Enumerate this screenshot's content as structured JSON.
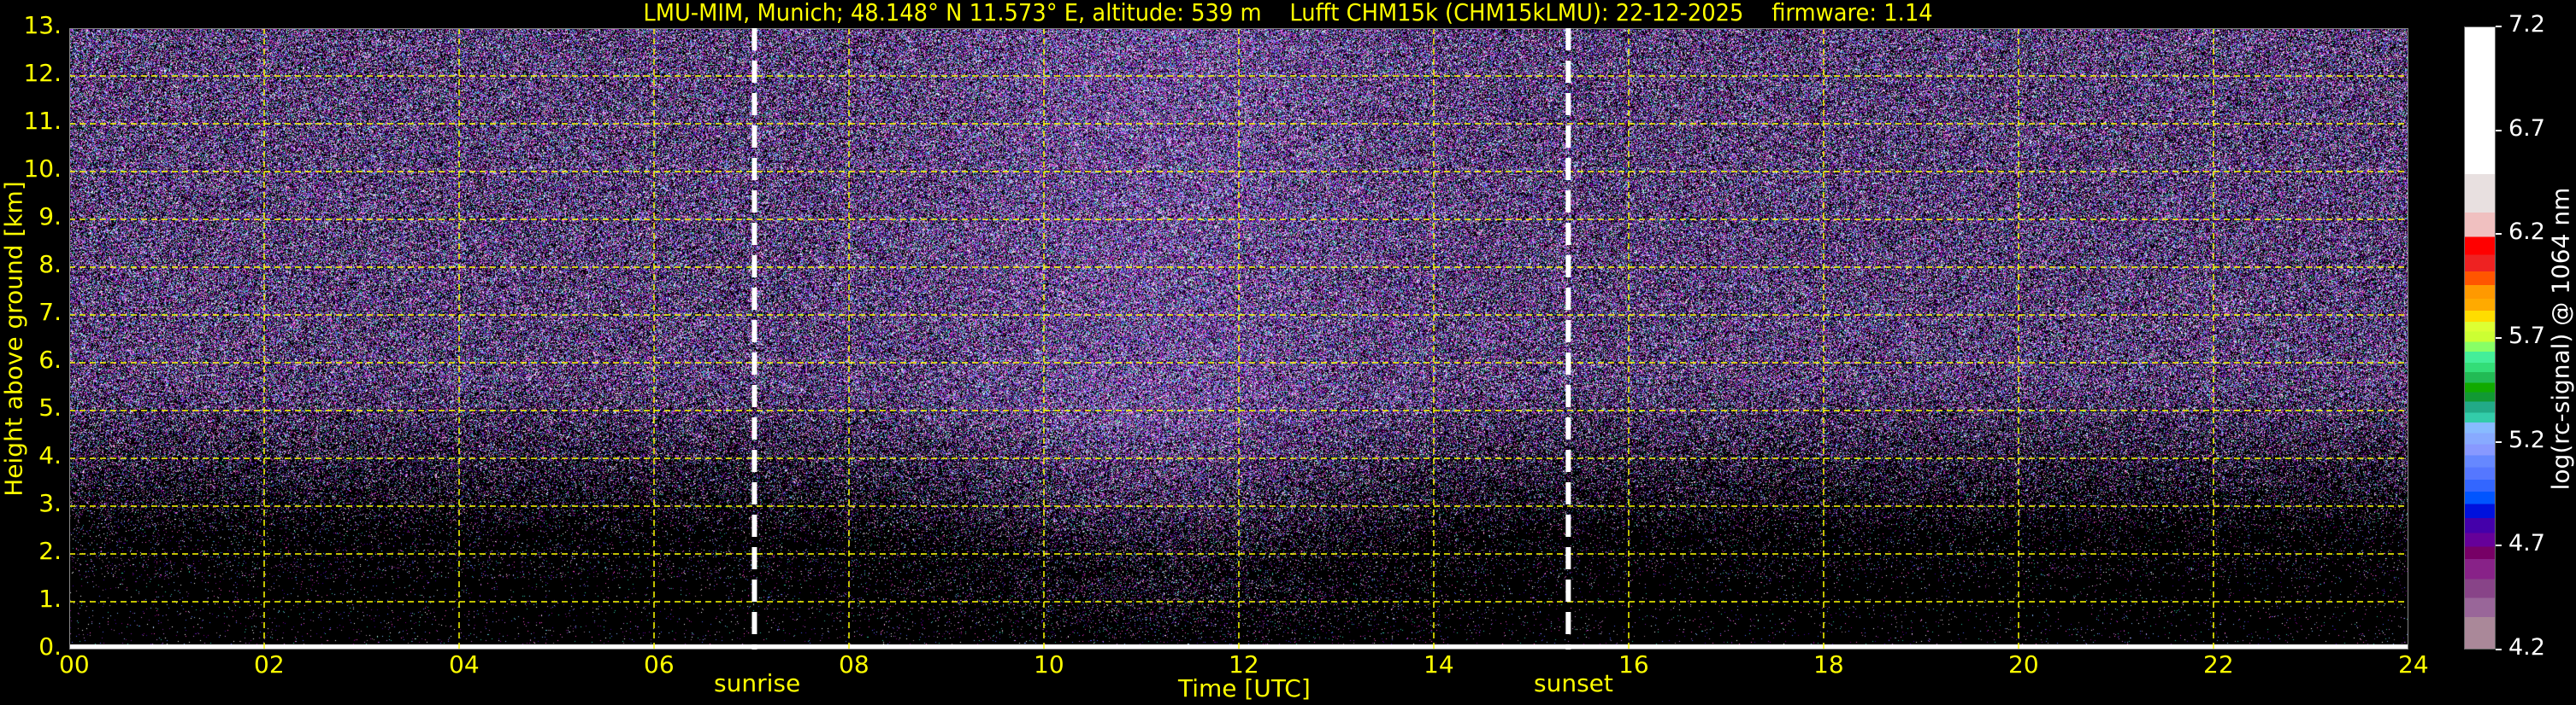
{
  "chart_data": {
    "type": "heatmap",
    "title": "LMU-MIM, Munich; 48.148° N 11.573° E, altitude: 539 m    Lufft CHM15k (CHM15kLMU): 22-12-2025    firmware: 1.14",
    "xlabel": "Time [UTC]",
    "ylabel": "Height above ground [km]",
    "xlim": [
      0,
      24
    ],
    "ylim": [
      0,
      13
    ],
    "grid": true,
    "x_ticks": [
      "00",
      "02",
      "04",
      "06",
      "08",
      "10",
      "12",
      "14",
      "16",
      "18",
      "20",
      "22",
      "24"
    ],
    "y_ticks": [
      "0.",
      "1.",
      "2.",
      "3.",
      "4.",
      "5.",
      "6.",
      "7.",
      "8.",
      "9.",
      "10.",
      "11.",
      "12.",
      "13."
    ],
    "annotations": [
      {
        "label": "sunrise",
        "x": 7.03
      },
      {
        "label": "sunset",
        "x": 15.38
      }
    ],
    "colorbar": {
      "label": "log(rc-signal) @ 1064 nm",
      "range": [
        4.2,
        7.2
      ],
      "ticks": [
        "7.2",
        "6.7",
        "6.2",
        "5.7",
        "5.2",
        "4.7",
        "4.2"
      ],
      "colors": [
        "#ffffff",
        "#e8e0e0",
        "#f0c0c0",
        "#ff0000",
        "#ee2222",
        "#ff5500",
        "#ff9900",
        "#ffaa00",
        "#ffdd00",
        "#ddff33",
        "#ccff33",
        "#88ff66",
        "#44ee99",
        "#33dd77",
        "#22bb55",
        "#11aa00",
        "#119933",
        "#22aa88",
        "#33ccaa",
        "#88bbff",
        "#88aaff",
        "#8899ff",
        "#6688ff",
        "#5577ff",
        "#3366ff",
        "#0055ff",
        "#0011dd",
        "#4400aa",
        "#660099",
        "#770066",
        "#882288",
        "#884488",
        "#996699",
        "#aa8899"
      ]
    },
    "grid_color": "#ffff00",
    "text_color": "#ffff00"
  }
}
